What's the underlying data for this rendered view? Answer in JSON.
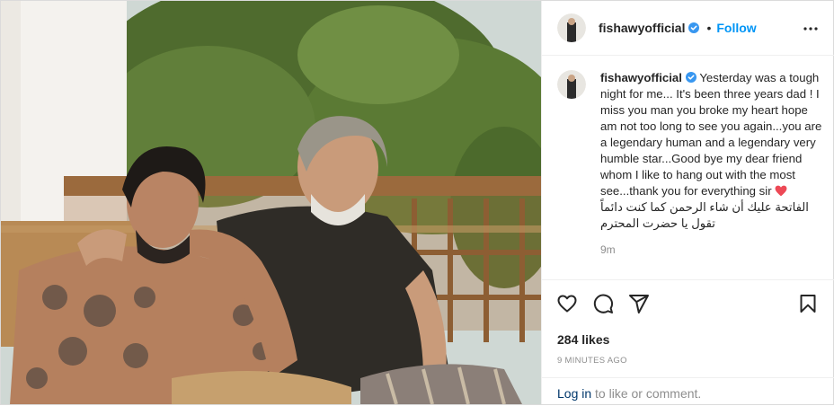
{
  "post": {
    "username": "fishawyofficial",
    "separator": "•",
    "follow_label": "Follow",
    "more_icon": "more-horizontal-icon",
    "verified_color": "#3897f0",
    "follow_color": "#0095f6"
  },
  "caption": {
    "username": "fishawyofficial",
    "text": "Yesterday was a tough night for me... It's been three years dad ! I miss you man you broke my heart hope am not too long to see you again...you are a legendary human and a legendary very humble star...Good bye my dear friend whom I like to hang out with the most see...thank you for everything sir",
    "arabic": "الفاتحة عليك أن شاء الرحمن كما كنت دائماً تقول يا حضرت المحترم",
    "relative_time": "9m",
    "heart_color": "#ed4956"
  },
  "actions": {
    "like_icon": "heart-outline-icon",
    "comment_icon": "comment-icon",
    "share_icon": "paper-plane-icon",
    "save_icon": "bookmark-icon"
  },
  "likes": "284 likes",
  "timestamp": "9 MINUTES AGO",
  "comment": {
    "login_label": "Log in",
    "suffix": " to like or comment."
  }
}
